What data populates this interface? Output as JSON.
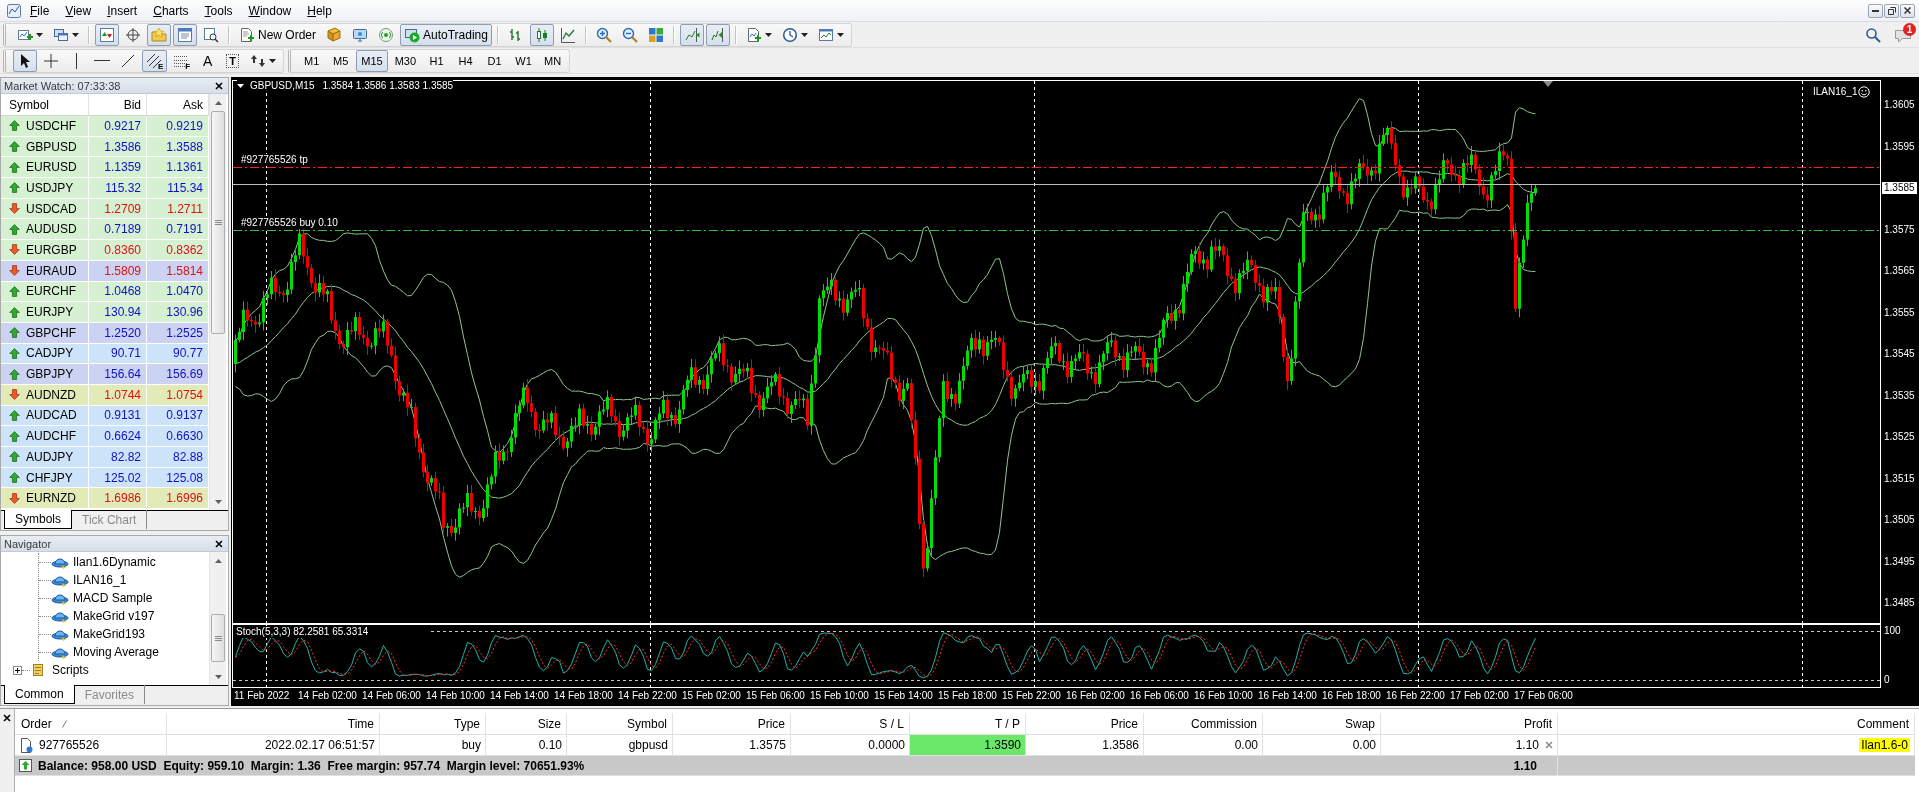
{
  "menu": [
    "File",
    "View",
    "Insert",
    "Charts",
    "Tools",
    "Window",
    "Help"
  ],
  "toolbar_main": {
    "groups": [
      [
        {
          "kind": "new-chart",
          "pressed": false,
          "dropdown": true
        },
        {
          "kind": "profiles",
          "pressed": false,
          "dropdown": true
        }
      ],
      [
        {
          "kind": "market-watch",
          "pressed": true,
          "dropdown": false
        },
        {
          "kind": "data-window",
          "pressed": false,
          "dropdown": false
        },
        {
          "kind": "navigator",
          "pressed": true,
          "dropdown": false
        },
        {
          "kind": "terminal",
          "pressed": true,
          "dropdown": false
        },
        {
          "kind": "tester",
          "pressed": false,
          "dropdown": false
        }
      ],
      [
        {
          "kind": "new-order",
          "label": "New Order",
          "pressed": false,
          "dropdown": false
        },
        {
          "kind": "editor",
          "pressed": false,
          "dropdown": false
        },
        {
          "kind": "signals",
          "pressed": false,
          "dropdown": false
        },
        {
          "kind": "market",
          "pressed": false,
          "dropdown": false
        },
        {
          "kind": "autotrading",
          "label": "AutoTrading",
          "pressed": true,
          "dropdown": false
        }
      ],
      [
        {
          "kind": "bar-chart",
          "pressed": false,
          "dropdown": false
        },
        {
          "kind": "candles",
          "pressed": true,
          "dropdown": false
        },
        {
          "kind": "line-chart",
          "pressed": false,
          "dropdown": false
        }
      ],
      [
        {
          "kind": "zoom-in",
          "pressed": false,
          "dropdown": false
        },
        {
          "kind": "zoom-out",
          "pressed": false,
          "dropdown": false
        },
        {
          "kind": "tile",
          "pressed": false,
          "dropdown": false
        }
      ],
      [
        {
          "kind": "chart-shift",
          "pressed": true,
          "dropdown": false
        },
        {
          "kind": "autoscroll",
          "pressed": true,
          "dropdown": false
        }
      ],
      [
        {
          "kind": "indicators",
          "pressed": false,
          "dropdown": true
        },
        {
          "kind": "periods",
          "pressed": false,
          "dropdown": true
        },
        {
          "kind": "templates",
          "pressed": false,
          "dropdown": true
        }
      ]
    ]
  },
  "toolbar_drawing": [
    {
      "kind": "cursor",
      "pressed": true,
      "dropdown": false
    },
    {
      "kind": "crosshair",
      "pressed": false,
      "dropdown": false
    },
    {
      "kind": "vline",
      "pressed": false,
      "dropdown": false
    },
    {
      "kind": "hline",
      "pressed": false,
      "dropdown": false
    },
    {
      "kind": "trendline",
      "pressed": false,
      "dropdown": false
    },
    {
      "kind": "channel",
      "glyph": "E",
      "pressed": true,
      "dropdown": false
    },
    {
      "kind": "fibonacci",
      "glyph": "F",
      "pressed": false,
      "dropdown": false
    },
    {
      "kind": "text",
      "glyph": "A",
      "pressed": false,
      "dropdown": false
    },
    {
      "kind": "label",
      "glyph": "T",
      "pressed": false,
      "dropdown": false
    },
    {
      "kind": "arrows",
      "pressed": false,
      "dropdown": true
    }
  ],
  "timeframes": [
    {
      "label": "M1",
      "selected": false
    },
    {
      "label": "M5",
      "selected": false
    },
    {
      "label": "M15",
      "selected": true
    },
    {
      "label": "M30",
      "selected": false
    },
    {
      "label": "H1",
      "selected": false
    },
    {
      "label": "H4",
      "selected": false
    },
    {
      "label": "D1",
      "selected": false
    },
    {
      "label": "W1",
      "selected": false
    },
    {
      "label": "MN",
      "selected": false
    }
  ],
  "notifications": {
    "count": "1"
  },
  "market_watch": {
    "title": "Market Watch: 07:33:38",
    "columns": [
      "Symbol",
      "Bid",
      "Ask"
    ],
    "rows": [
      {
        "symbol": "USDCHF",
        "bid": "0.9217",
        "ask": "0.9219",
        "rising": true,
        "color": "#d6f0d2"
      },
      {
        "symbol": "GBPUSD",
        "bid": "1.3586",
        "ask": "1.3588",
        "rising": true,
        "color": "#d6f0d2"
      },
      {
        "symbol": "EURUSD",
        "bid": "1.1359",
        "ask": "1.1361",
        "rising": true,
        "color": "#d6f0d2"
      },
      {
        "symbol": "USDJPY",
        "bid": "115.32",
        "ask": "115.34",
        "rising": true,
        "color": "#d6f0d2"
      },
      {
        "symbol": "USDCAD",
        "bid": "1.2709",
        "ask": "1.2711",
        "rising": false,
        "color": "#d6f0d2"
      },
      {
        "symbol": "AUDUSD",
        "bid": "0.7189",
        "ask": "0.7191",
        "rising": true,
        "color": "#d6f0d2"
      },
      {
        "symbol": "EURGBP",
        "bid": "0.8360",
        "ask": "0.8362",
        "rising": false,
        "color": "#d6f0d2"
      },
      {
        "symbol": "EURAUD",
        "bid": "1.5809",
        "ask": "1.5814",
        "rising": false,
        "color": "#ccd3f2"
      },
      {
        "symbol": "EURCHF",
        "bid": "1.0468",
        "ask": "1.0470",
        "rising": true,
        "color": "#d6f0d2"
      },
      {
        "symbol": "EURJPY",
        "bid": "130.94",
        "ask": "130.96",
        "rising": true,
        "color": "#d6f0d2"
      },
      {
        "symbol": "GBPCHF",
        "bid": "1.2520",
        "ask": "1.2525",
        "rising": true,
        "color": "#ccd3f2"
      },
      {
        "symbol": "CADJPY",
        "bid": "90.71",
        "ask": "90.77",
        "rising": true,
        "color": "#cde3f9"
      },
      {
        "symbol": "GBPJPY",
        "bid": "156.64",
        "ask": "156.69",
        "rising": true,
        "color": "#ccd3f2"
      },
      {
        "symbol": "AUDNZD",
        "bid": "1.0744",
        "ask": "1.0754",
        "rising": false,
        "color": "#e2ebb8"
      },
      {
        "symbol": "AUDCAD",
        "bid": "0.9131",
        "ask": "0.9137",
        "rising": true,
        "color": "#cde3f9"
      },
      {
        "symbol": "AUDCHF",
        "bid": "0.6624",
        "ask": "0.6630",
        "rising": true,
        "color": "#cde3f9"
      },
      {
        "symbol": "AUDJPY",
        "bid": "82.82",
        "ask": "82.88",
        "rising": true,
        "color": "#cde3f9"
      },
      {
        "symbol": "CHFJPY",
        "bid": "125.02",
        "ask": "125.08",
        "rising": true,
        "color": "#cde3f9"
      },
      {
        "symbol": "EURNZD",
        "bid": "1.6986",
        "ask": "1.6996",
        "rising": false,
        "color": "#e2ebb8"
      }
    ],
    "tabs": [
      {
        "label": "Symbols",
        "selected": true
      },
      {
        "label": "Tick Chart",
        "selected": false
      }
    ]
  },
  "navigator": {
    "title": "Navigator",
    "tree": [
      {
        "kind": "group",
        "expanded": true,
        "children": [
          {
            "kind": "expert",
            "label": "Ilan1.6Dynamic"
          },
          {
            "kind": "expert",
            "label": "ILAN16_1"
          },
          {
            "kind": "expert",
            "label": "MACD Sample"
          },
          {
            "kind": "expert",
            "label": "MakeGrid v197"
          },
          {
            "kind": "expert",
            "label": "MakeGrid193"
          },
          {
            "kind": "expert",
            "label": "Moving Average"
          }
        ]
      },
      {
        "kind": "folder",
        "label": "Scripts",
        "expanded": false
      }
    ],
    "tabs": [
      {
        "label": "Common",
        "selected": true
      },
      {
        "label": "Favorites",
        "selected": false
      }
    ]
  },
  "chart": {
    "symbol": "GBPUSD,M15",
    "ohlc": "1.3584 1.3586 1.3583 1.3585",
    "expert": "ILAN16_1",
    "order_lines": [
      {
        "kind": "take-profit",
        "label": "#927765526 tp"
      },
      {
        "kind": "entry",
        "label": "#927765526 buy 0.10"
      }
    ],
    "price_axis": [
      {
        "text": "1.3605",
        "current": false
      },
      {
        "text": "1.3595",
        "current": false
      },
      {
        "text": "1.3585",
        "current": true
      },
      {
        "text": "1.3575",
        "current": false
      },
      {
        "text": "1.3565",
        "current": false
      },
      {
        "text": "1.3555",
        "current": false
      },
      {
        "text": "1.3545",
        "current": false
      },
      {
        "text": "1.3535",
        "current": false
      },
      {
        "text": "1.3525",
        "current": false
      },
      {
        "text": "1.3515",
        "current": false
      },
      {
        "text": "1.3505",
        "current": false
      },
      {
        "text": "1.3495",
        "current": false
      },
      {
        "text": "1.3485",
        "current": false
      }
    ],
    "time_axis": [
      "11 Feb 2022",
      "14 Feb 02:00",
      "14 Feb 06:00",
      "14 Feb 10:00",
      "14 Feb 14:00",
      "14 Feb 18:00",
      "14 Feb 22:00",
      "15 Feb 02:00",
      "15 Feb 06:00",
      "15 Feb 10:00",
      "15 Feb 14:00",
      "15 Feb 18:00",
      "15 Feb 22:00",
      "16 Feb 02:00",
      "16 Feb 06:00",
      "16 Feb 10:00",
      "16 Feb 14:00",
      "16 Feb 18:00",
      "16 Feb 22:00",
      "17 Feb 02:00",
      "17 Feb 06:00"
    ],
    "indicator": {
      "label": "Stoch(5,3,3) 82.2581 65.3314",
      "axis": [
        "100",
        "0"
      ]
    }
  },
  "terminal": {
    "columns": [
      {
        "label": "Order",
        "sorted": true
      },
      {
        "label": "Time",
        "sorted": false
      },
      {
        "label": "Type",
        "sorted": false
      },
      {
        "label": "Size",
        "sorted": false
      },
      {
        "label": "Symbol",
        "sorted": false
      },
      {
        "label": "Price",
        "sorted": false
      },
      {
        "label": "S / L",
        "sorted": false
      },
      {
        "label": "T / P",
        "sorted": false
      },
      {
        "label": "Price",
        "sorted": false
      },
      {
        "label": "Commission",
        "sorted": false
      },
      {
        "label": "Swap",
        "sorted": false
      },
      {
        "label": "Profit",
        "sorted": false
      },
      {
        "label": "Comment",
        "sorted": false
      }
    ],
    "orders": [
      {
        "order": "927765526",
        "time": "2022.02.17 06:51:57",
        "type": "buy",
        "size": "0.10",
        "symbol": "gbpusd",
        "price": "1.3575",
        "sl": "0.0000",
        "tp": "1.3590",
        "tp_highlighted": true,
        "price_current": "1.3586",
        "commission": "0.00",
        "swap": "0.00",
        "profit": "1.10",
        "comment": "Ilan1.6-0",
        "comment_highlighted": true
      }
    ],
    "summary": {
      "text": "Balance: 958.00 USD  Equity: 959.10  Margin: 1.36  Free margin: 957.74  Margin level: 70651.93%",
      "profit": "1.10"
    }
  }
}
